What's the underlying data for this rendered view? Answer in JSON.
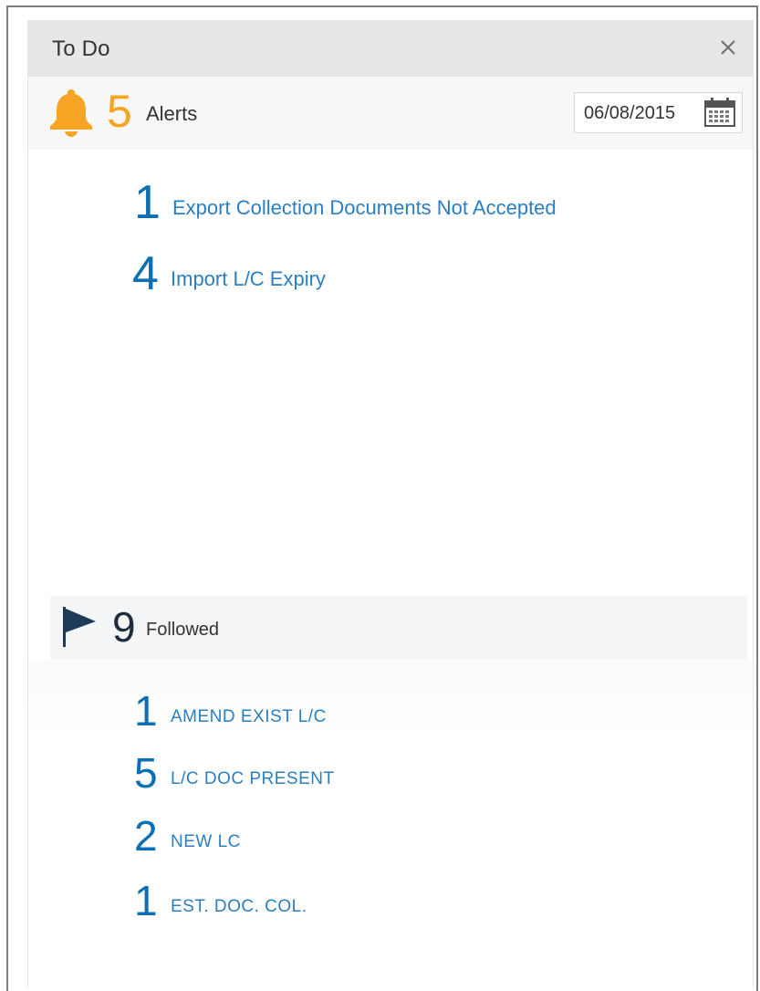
{
  "panel": {
    "title": "To Do"
  },
  "alerts": {
    "count": "5",
    "label": "Alerts",
    "date": "06/08/2015",
    "items": [
      {
        "count": "1",
        "label": "Export Collection Documents Not Accepted"
      },
      {
        "count": "4",
        "label": "Import L/C Expiry"
      }
    ]
  },
  "followed": {
    "count": "9",
    "label": "Followed",
    "items": [
      {
        "count": "1",
        "label": "AMEND EXIST L/C"
      },
      {
        "count": "5",
        "label": "L/C DOC PRESENT"
      },
      {
        "count": "2",
        "label": "NEW LC"
      },
      {
        "count": "1",
        "label": "EST. DOC. COL."
      }
    ]
  },
  "icons": {
    "close": "close-icon",
    "bell": "bell-icon",
    "calendar": "calendar-icon",
    "flag": "flag-icon"
  },
  "colors": {
    "alert_accent": "#f5a523",
    "link_blue": "#2b7ec2",
    "count_blue": "#0a6fb4",
    "flag_navy": "#1e3a5a"
  }
}
